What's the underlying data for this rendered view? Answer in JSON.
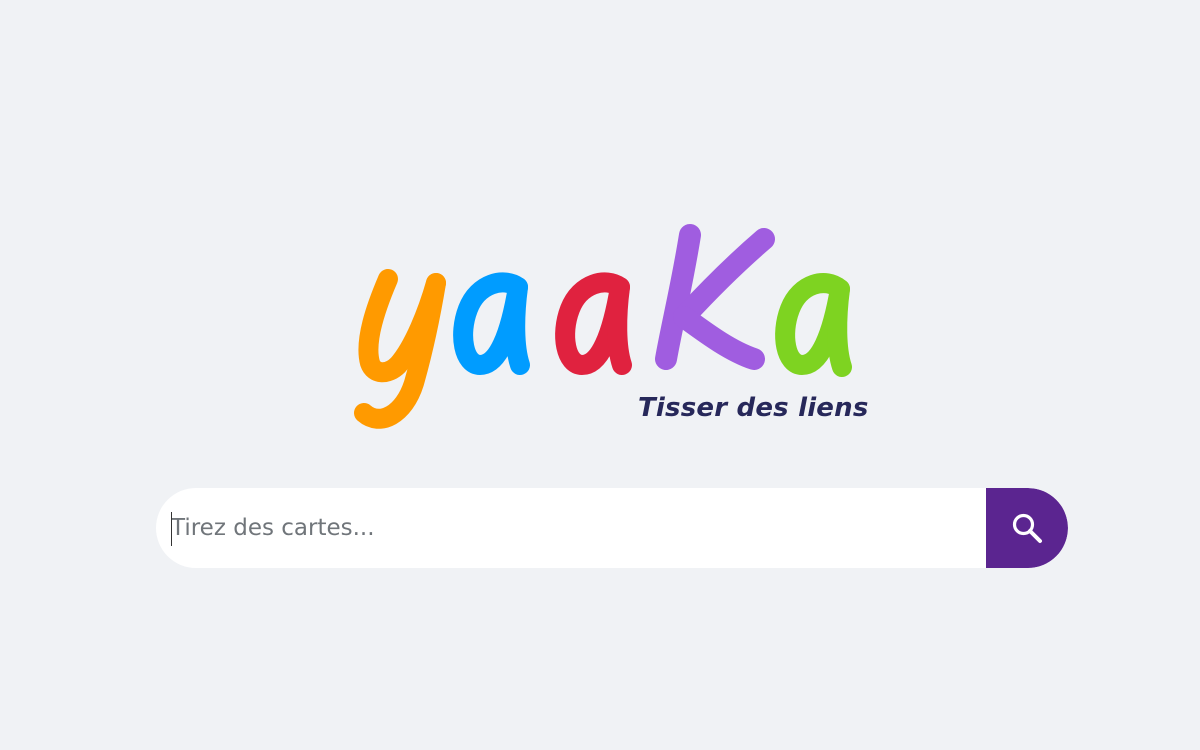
{
  "logo": {
    "letters": [
      "y",
      "a",
      "a",
      "K",
      "a"
    ],
    "colors": [
      "#ff9a00",
      "#009cff",
      "#e0223f",
      "#a05de0",
      "#7ed321"
    ]
  },
  "tagline": "Tisser des liens",
  "search": {
    "placeholder": "Tirez des cartes...",
    "value": "",
    "button_color": "#5b2590",
    "icon": "search-icon"
  },
  "theme": {
    "background": "#f0f2f5",
    "tagline_color": "#27285a"
  }
}
